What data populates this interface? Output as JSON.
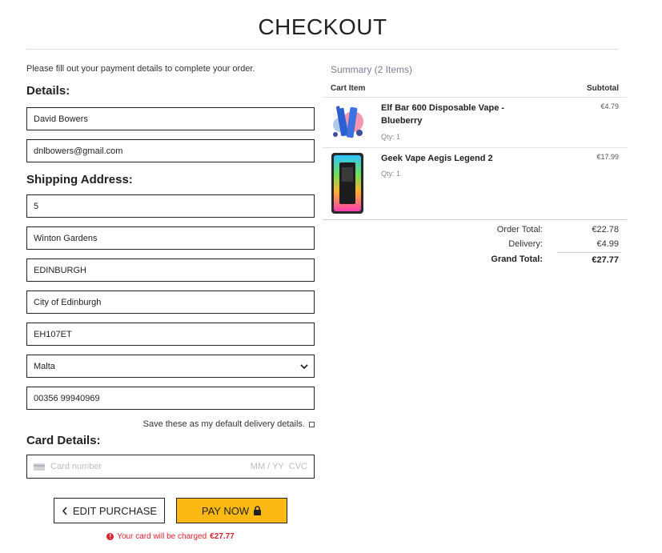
{
  "header": {
    "title": "CHECKOUT"
  },
  "form": {
    "intro": "Please fill out your payment details to complete your order.",
    "details_heading": "Details:",
    "full_name": "David Bowers",
    "email": "dnlbowers@gmail.com",
    "shipping_heading": "Shipping Address:",
    "address_line1": "5",
    "address_line2": "Winton Gardens",
    "town": "EDINBURGH",
    "county": "City of Edinburgh",
    "postcode": "EH107ET",
    "country": "Malta",
    "phone": "00356 99940969",
    "save_default_label": "Save these as my default delivery details.",
    "card_heading": "Card Details:",
    "card_number_placeholder": "Card number",
    "card_expiry_placeholder": "MM / YY",
    "card_cvc_placeholder": "CVC"
  },
  "buttons": {
    "edit_purchase": "EDIT PURCHASE",
    "pay_now": "PAY NOW"
  },
  "charge_notice": {
    "text": "Your card will be charged",
    "amount": "€27.77"
  },
  "summary": {
    "title": "Summary (2 Items)",
    "col_item": "Cart Item",
    "col_subtotal": "Subtotal",
    "items": [
      {
        "name": "Elf Bar 600 Disposable Vape - Blueberry",
        "qty": "Qty: 1",
        "price": "€4.79"
      },
      {
        "name": "Geek Vape Aegis Legend 2",
        "qty": "Qty: 1",
        "price": "€17.99"
      }
    ],
    "order_total_label": "Order Total:",
    "order_total": "€22.78",
    "delivery_label": "Delivery:",
    "delivery": "€4.99",
    "grand_total_label": "Grand Total:",
    "grand_total": "€27.77"
  },
  "colors": {
    "accent": "#fdb913",
    "error": "#d9232e"
  },
  "icons": [
    "chevron-down-icon",
    "checkbox-icon",
    "credit-card-icon",
    "chevron-left-icon",
    "lock-icon",
    "alert-icon"
  ]
}
